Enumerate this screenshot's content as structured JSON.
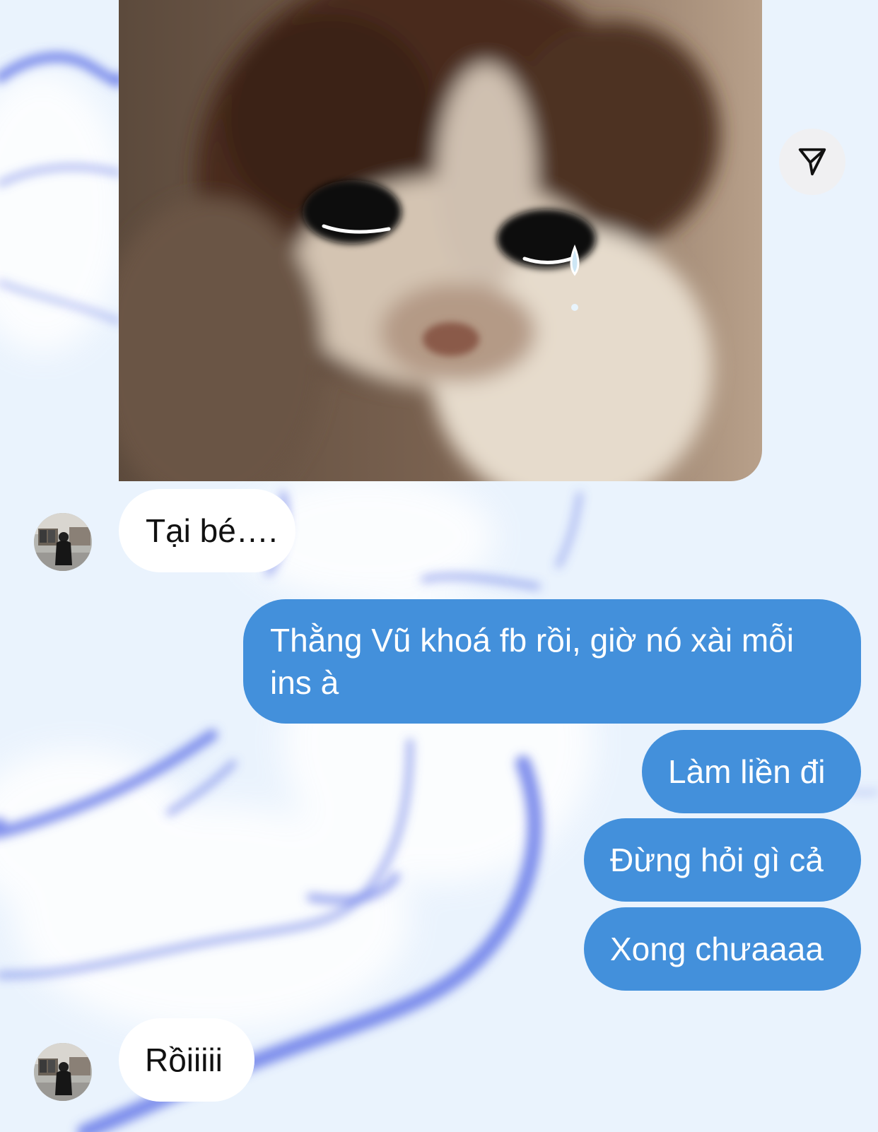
{
  "theme": {
    "background": "#eaf3fd",
    "outgoing_bubble_color": "#4390db",
    "incoming_bubble_color": "#ffffff"
  },
  "image_message": {
    "icon": "sad-crying-kitten-photo",
    "action_icon": "paper-plane-send-icon"
  },
  "messages": [
    {
      "direction": "incoming",
      "text": "Tại bé…."
    },
    {
      "direction": "outgoing",
      "text": "Thằng Vũ khoá fb rồi, giờ nó xài mỗi ins à"
    },
    {
      "direction": "outgoing",
      "text": "Làm liền đi"
    },
    {
      "direction": "outgoing",
      "text": "Đừng hỏi gì cả"
    },
    {
      "direction": "outgoing",
      "text": "Xong chưaaaa"
    },
    {
      "direction": "incoming",
      "text": "Rồiiiii"
    }
  ]
}
